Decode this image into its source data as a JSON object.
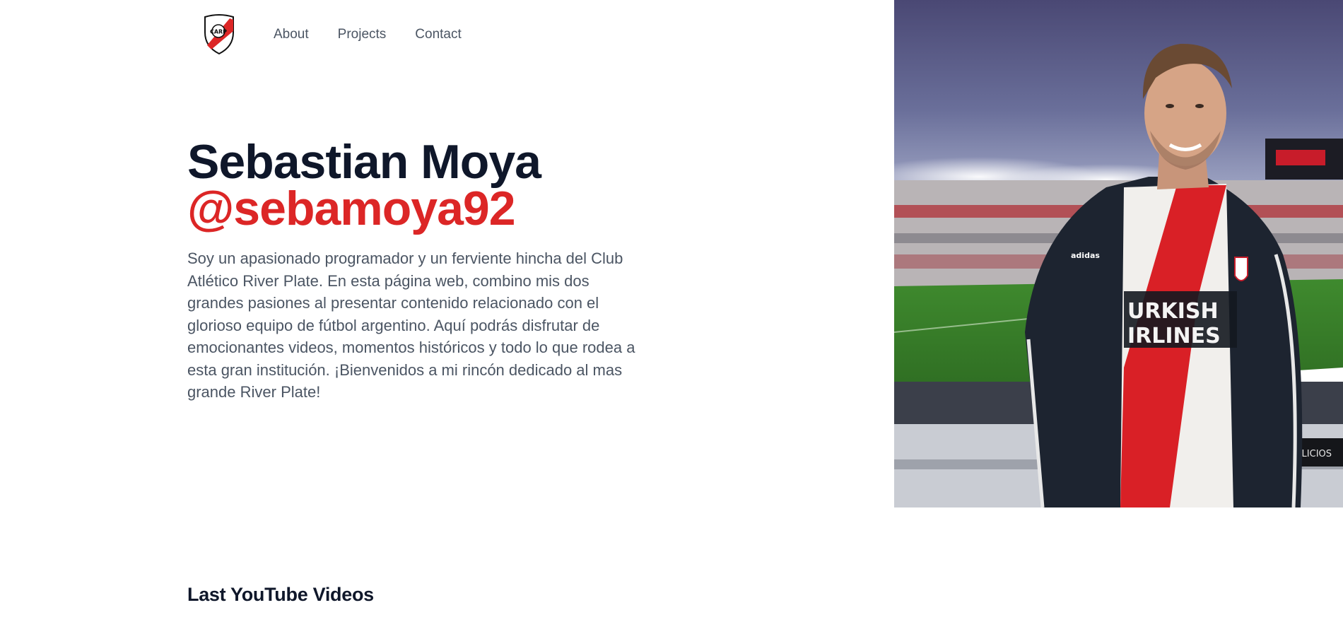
{
  "nav": {
    "logo_label": "CARP",
    "items": [
      {
        "label": "About"
      },
      {
        "label": "Projects"
      },
      {
        "label": "Contact"
      }
    ]
  },
  "hero": {
    "name": "Sebastian Moya",
    "handle": "@sebamoya92",
    "bio": "Soy un apasionado programador y un ferviente hincha del Club Atlético River Plate. En esta página web, combino mis dos grandes pasiones al presentar contenido relacionado con el glorioso equipo de fútbol argentino. Aquí podrás disfrutar de emocionantes videos, momentos históricos y todo lo que rodea a esta gran institución. ¡Bienvenidos a mi rincón dedicado al mas grande River Plate!"
  },
  "photo": {
    "shirt_line1": "URKISH",
    "shirt_line2": "IRLINES",
    "sponsor_brand": "adidas",
    "board_text": "VITALICIOS"
  },
  "sections": {
    "videos_title": "Last YouTube Videos"
  },
  "colors": {
    "accent": "#dc2626",
    "heading": "#0f172a",
    "body_text": "#4b5563"
  }
}
